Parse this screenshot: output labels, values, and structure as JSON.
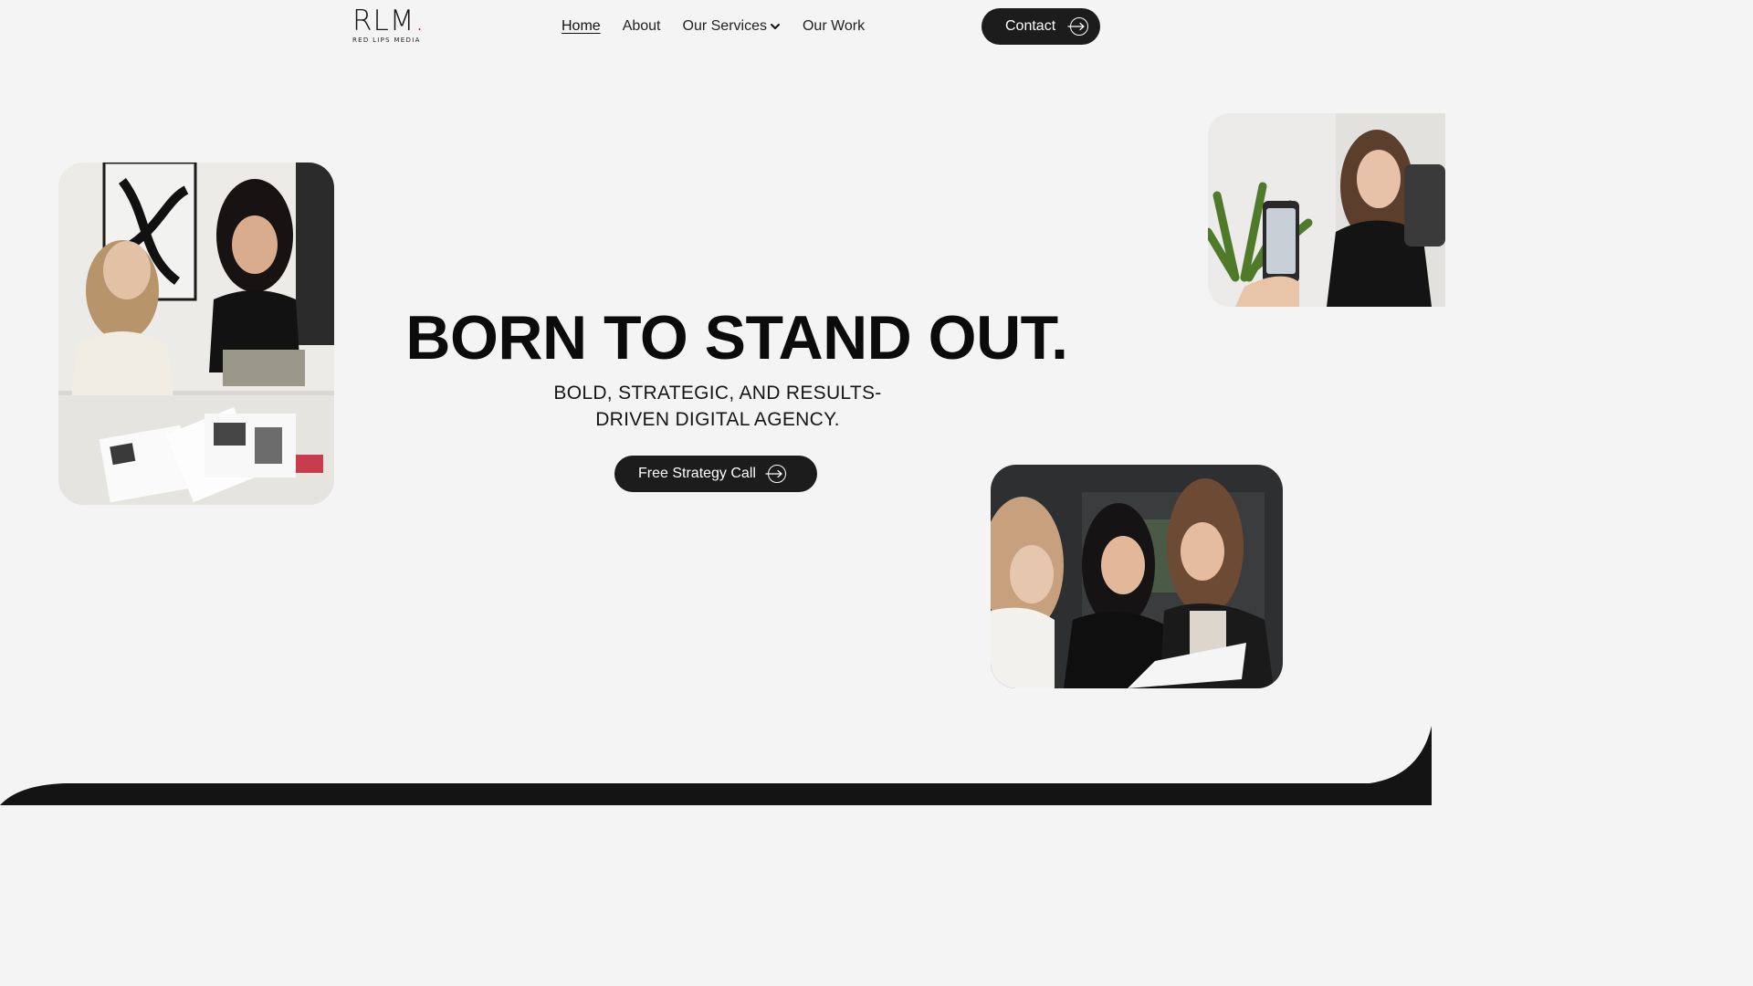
{
  "logo": {
    "mark": "RLM",
    "dot": ".",
    "subtitle": "RED LIPS MEDIA"
  },
  "nav": {
    "items": [
      {
        "label": "Home",
        "active": true
      },
      {
        "label": "About"
      },
      {
        "label": "Our Services",
        "has_dropdown": true
      },
      {
        "label": "Our Work"
      }
    ]
  },
  "contact_button": {
    "label": "Contact"
  },
  "hero": {
    "title": "BORN TO STAND OUT.",
    "subtitle": "BOLD, STRATEGIC, AND RESULTS-DRIVEN DIGITAL AGENCY.",
    "cta_label": "Free Strategy Call"
  },
  "colors": {
    "background": "#f4f4f4",
    "button": "#1c1c1c",
    "text": "#0b0b0b",
    "logo_accent": "#c8102e"
  }
}
